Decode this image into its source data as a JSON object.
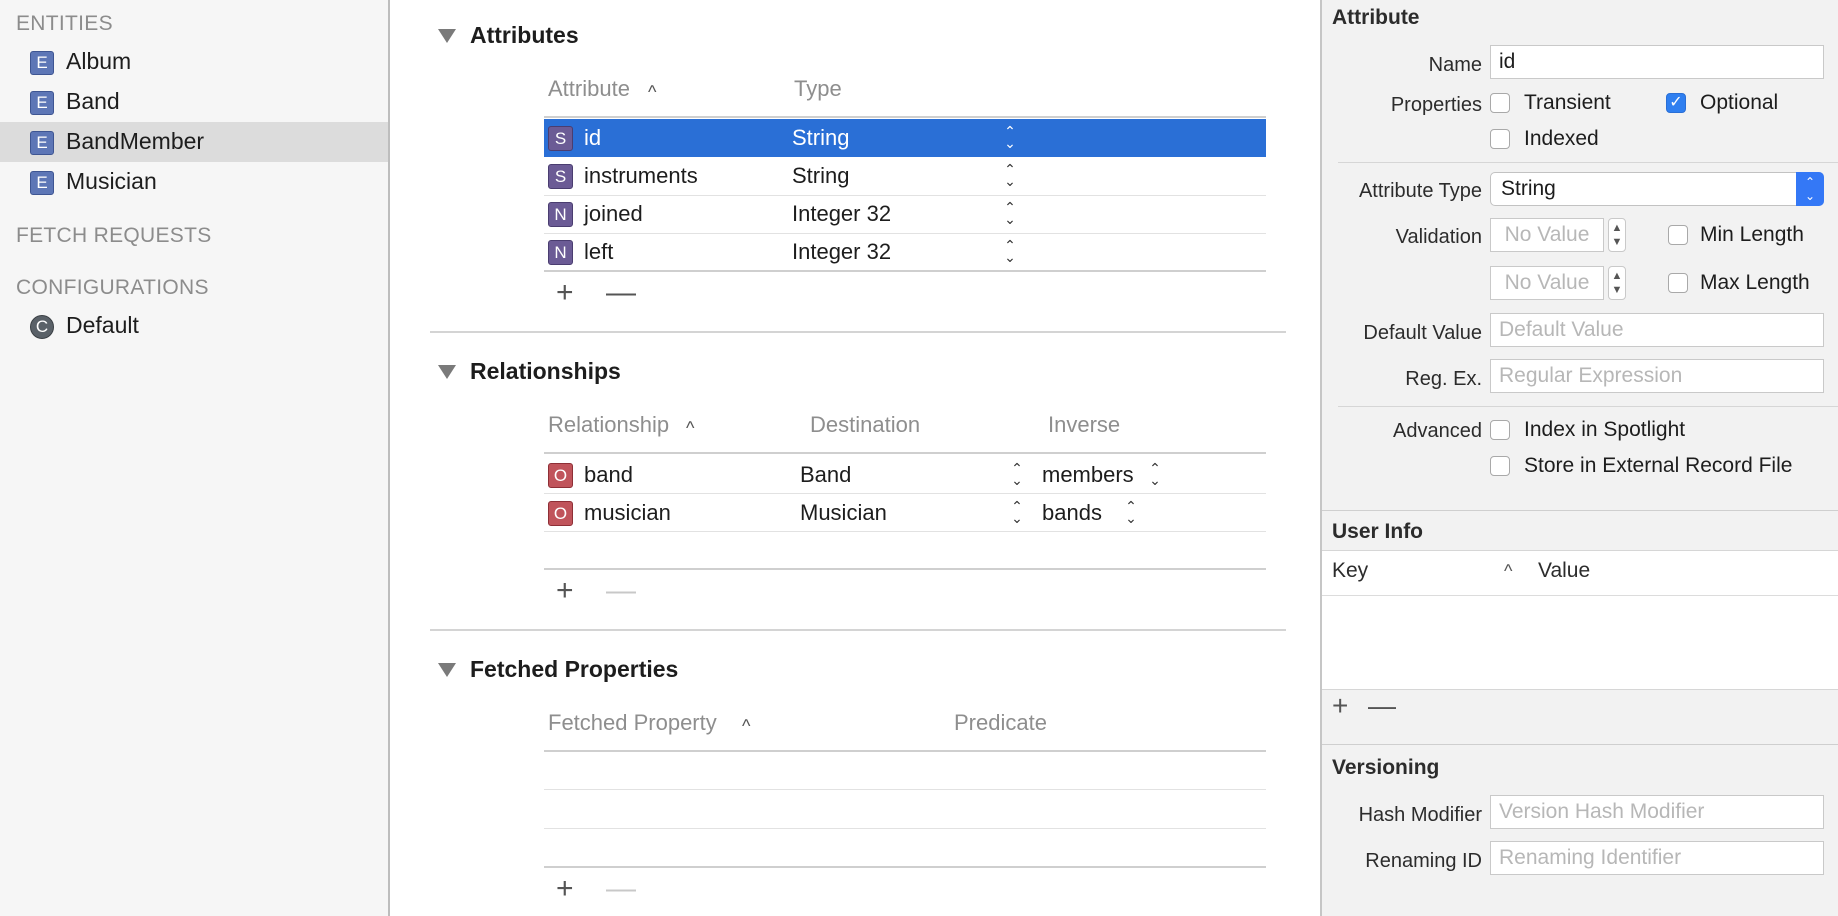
{
  "sidebar": {
    "entities_header": "ENTITIES",
    "entities": [
      {
        "icon": "E",
        "label": "Album",
        "selected": false
      },
      {
        "icon": "E",
        "label": "Band",
        "selected": false
      },
      {
        "icon": "E",
        "label": "BandMember",
        "selected": true
      },
      {
        "icon": "E",
        "label": "Musician",
        "selected": false
      }
    ],
    "fetch_requests_header": "FETCH REQUESTS",
    "configurations_header": "CONFIGURATIONS",
    "configurations": [
      {
        "icon": "C",
        "label": "Default"
      }
    ]
  },
  "attributes": {
    "title": "Attributes",
    "col_attribute": "Attribute",
    "col_type": "Type",
    "sort_caret": "^",
    "rows": [
      {
        "badge": "S",
        "name": "id",
        "type": "String",
        "selected": true
      },
      {
        "badge": "S",
        "name": "instruments",
        "type": "String",
        "selected": false
      },
      {
        "badge": "N",
        "name": "joined",
        "type": "Integer 32",
        "selected": false
      },
      {
        "badge": "N",
        "name": "left",
        "type": "Integer 32",
        "selected": false
      }
    ],
    "add": "+",
    "remove": "—"
  },
  "relationships": {
    "title": "Relationships",
    "col_relationship": "Relationship",
    "col_destination": "Destination",
    "col_inverse": "Inverse",
    "sort_caret": "^",
    "rows": [
      {
        "badge": "O",
        "name": "band",
        "destination": "Band",
        "inverse": "members"
      },
      {
        "badge": "O",
        "name": "musician",
        "destination": "Musician",
        "inverse": "bands"
      }
    ],
    "add": "+",
    "remove": "—"
  },
  "fetched": {
    "title": "Fetched Properties",
    "col_property": "Fetched Property",
    "col_predicate": "Predicate",
    "sort_caret": "^",
    "add": "+",
    "remove": "—"
  },
  "inspector": {
    "attribute_header": "Attribute",
    "name_label": "Name",
    "name_value": "id",
    "properties_label": "Properties",
    "transient": {
      "label": "Transient",
      "checked": false
    },
    "optional": {
      "label": "Optional",
      "checked": true,
      "mark": "✓"
    },
    "indexed": {
      "label": "Indexed",
      "checked": false
    },
    "attribute_type_label": "Attribute Type",
    "attribute_type_value": "String",
    "validation_label": "Validation",
    "min_placeholder": "No Value",
    "min_length": "Min Length",
    "max_placeholder": "No Value",
    "max_length": "Max Length",
    "default_value_label": "Default Value",
    "default_value_placeholder": "Default Value",
    "regex_label": "Reg. Ex.",
    "regex_placeholder": "Regular Expression",
    "advanced_label": "Advanced",
    "index_spotlight": "Index in Spotlight",
    "store_external": "Store in External Record File",
    "user_info_header": "User Info",
    "key_col": "Key",
    "key_caret": "^",
    "value_col": "Value",
    "add": "+",
    "remove": "—",
    "versioning_header": "Versioning",
    "hash_label": "Hash Modifier",
    "hash_placeholder": "Version Hash Modifier",
    "renaming_label": "Renaming ID",
    "renaming_placeholder": "Renaming Identifier"
  },
  "colors": {
    "selection_blue": "#2a6fd6",
    "entity_icon": "#5d76b6",
    "string_badge": "#6b5b95",
    "relationship_badge": "#c0545b"
  }
}
